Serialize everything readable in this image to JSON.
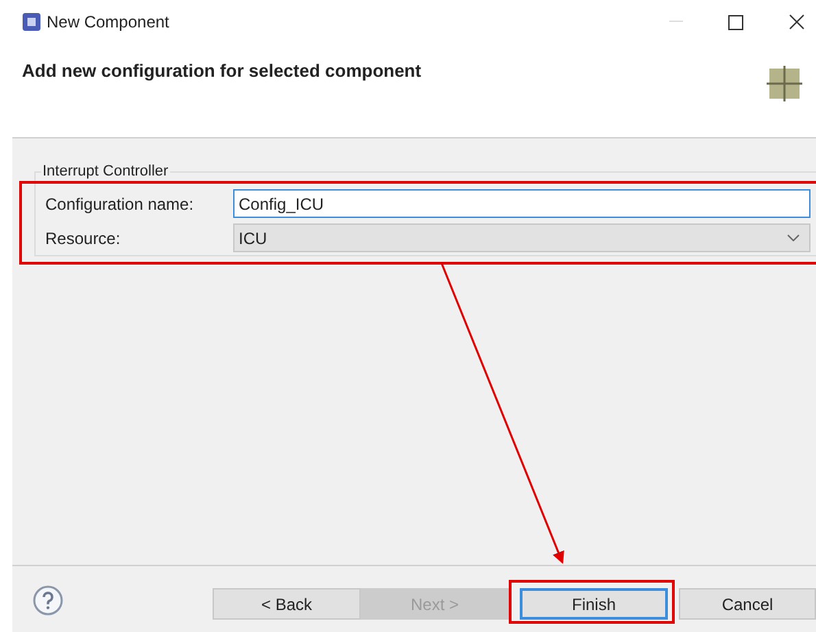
{
  "window": {
    "title": "New Component"
  },
  "header": {
    "title": "Add new configuration for selected component"
  },
  "group": {
    "label": "Interrupt Controller",
    "fields": [
      {
        "kind": "text",
        "label": "Configuration name:",
        "value": "Config_ICU"
      },
      {
        "kind": "dropdown",
        "label": "Resource:",
        "value": "ICU"
      }
    ]
  },
  "buttons": [
    {
      "label": "< Back",
      "disabled": false,
      "default": false
    },
    {
      "label": "Next >",
      "disabled": true,
      "default": false
    },
    {
      "label": "Finish",
      "disabled": false,
      "default": true
    },
    {
      "label": "Cancel",
      "disabled": false,
      "default": false
    }
  ]
}
